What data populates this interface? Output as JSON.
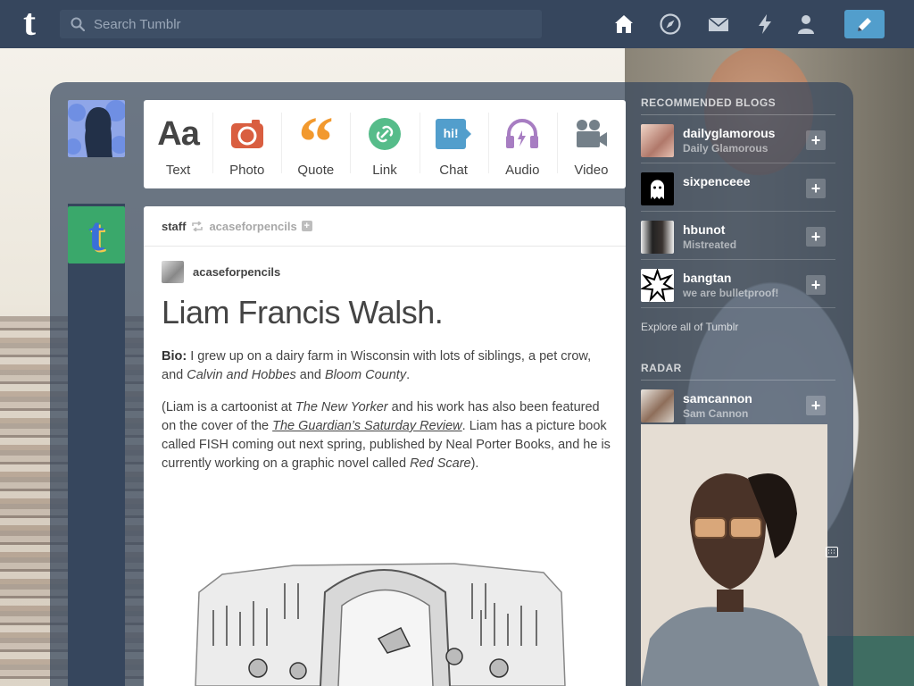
{
  "header": {
    "logo": "t",
    "search_placeholder": "Search Tumblr",
    "nav": [
      "home-icon",
      "explore-icon",
      "inbox-icon",
      "activity-icon",
      "account-icon"
    ],
    "compose_icon": "pencil-icon"
  },
  "post_types": [
    {
      "label": "Text",
      "icon": "text-icon",
      "glyph": "Aa",
      "color": "#444444"
    },
    {
      "label": "Photo",
      "icon": "photo-icon",
      "color": "#d95e40"
    },
    {
      "label": "Quote",
      "icon": "quote-icon",
      "glyph": "“",
      "color": "#f2992e"
    },
    {
      "label": "Link",
      "icon": "link-icon",
      "color": "#56bc8a"
    },
    {
      "label": "Chat",
      "icon": "chat-icon",
      "glyph": "hi!",
      "color": "#529ecc"
    },
    {
      "label": "Audio",
      "icon": "audio-icon",
      "color": "#a77dc2"
    },
    {
      "label": "Video",
      "icon": "video-icon",
      "color": "#748089"
    }
  ],
  "post": {
    "user": "staff",
    "reblogged_from": "acaseforpencils",
    "source_blog": "acaseforpencils",
    "title": "Liam Francis Walsh.",
    "bio_label": "Bio:",
    "bio_text_1": " I grew up on a dairy farm in Wisconsin with lots of siblings, a pet crow, and ",
    "bio_em_1": "Calvin and Hobbes",
    "bio_text_2": " and ",
    "bio_em_2": "Bloom County",
    "bio_text_3": ".",
    "p2_text_1": "(Liam is a cartoonist at ",
    "p2_em_1": "The New Yorker",
    "p2_text_2": " and his work has also been featured on the cover of the ",
    "p2_link": "The Guardian’s Saturday Review",
    "p2_text_3": ". Liam has a picture book called FISH coming out next spring, published by Neal Porter Books, and he is currently working on a graphic novel called ",
    "p2_em_2": "Red Scare",
    "p2_text_4": ")."
  },
  "sidebar": {
    "recommended_title": "RECOMMENDED BLOGS",
    "blogs": [
      {
        "name": "dailyglamorous",
        "title": "Daily Glamorous"
      },
      {
        "name": "sixpenceee",
        "title": ""
      },
      {
        "name": "hbunot",
        "title": "Mistreated"
      },
      {
        "name": "bangtan",
        "title": "we are bulletproof!"
      }
    ],
    "explore": "Explore all of Tumblr",
    "radar_title": "RADAR",
    "radar_blog": {
      "name": "samcannon",
      "title": "Sam Cannon"
    }
  }
}
